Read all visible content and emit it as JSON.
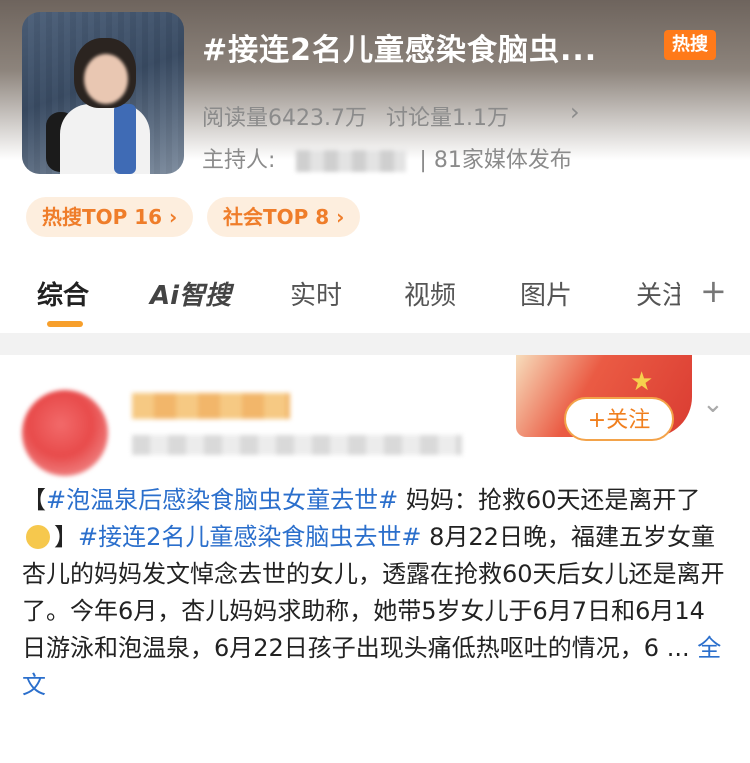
{
  "topic": {
    "title": "#接连2名儿童感染食脑虫...",
    "hot_badge": "热搜",
    "reads": "阅读量6423.7万",
    "discussions": "讨论量1.1万",
    "host_label": "主持人:",
    "media": "| 81家媒体发布",
    "pills": [
      "热搜TOP 16 ›",
      "社会TOP 8 ›"
    ]
  },
  "tabs": [
    "综合",
    "Ai智搜",
    "实时",
    "视频",
    "图片",
    "关注"
  ],
  "post": {
    "follow_label": "+关注",
    "tag1": "#泡温泉后感染食脑虫女童去世#",
    "text1": "妈妈：抢救60天还是离开了",
    "tag2": "#接连2名儿童感染食脑虫去世#",
    "text2": "8月22日晚，福建五岁女童杏儿的妈妈发文悼念去世的女儿，透露在抢救60天后女儿还是离开了。今年6月，杏儿妈妈求助称，她带5岁女儿于6月7日和6月14日游泳和泡温泉，6月22日孩子出现头痛低热呕吐的情况，6 ...",
    "more": "全文"
  },
  "colors": {
    "accent": "#f79f2b",
    "link": "#2b6fcc",
    "hot": "#ff7a1a"
  },
  "icons": [
    "chevron-right-icon",
    "plus-icon",
    "chevron-down-icon",
    "sad-emoji-icon"
  ]
}
